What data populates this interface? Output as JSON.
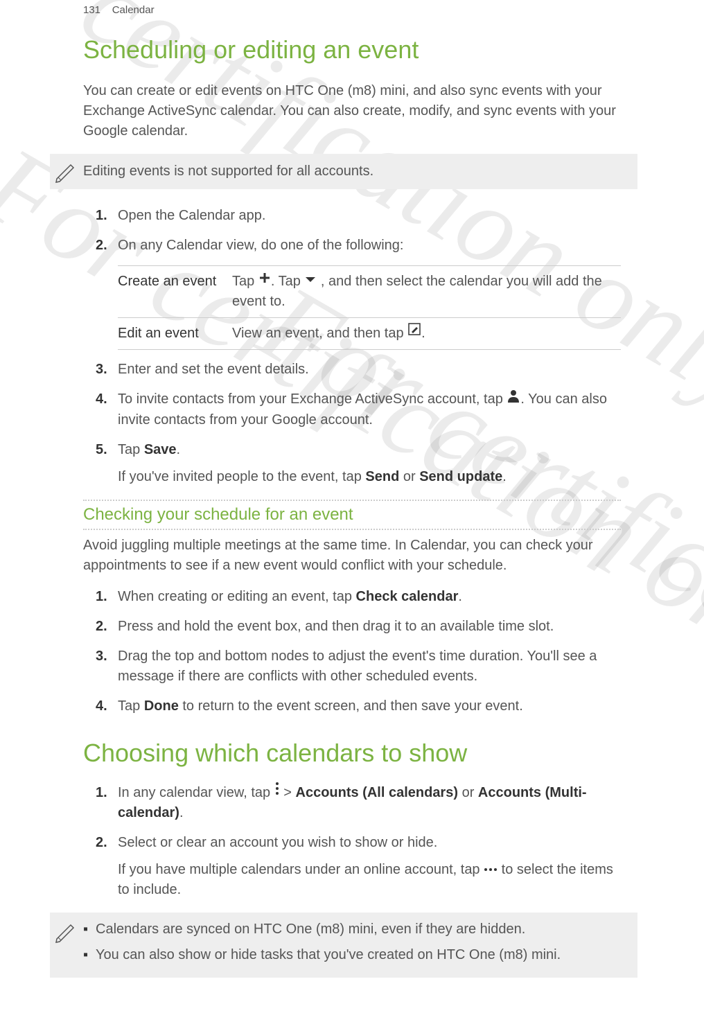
{
  "header": {
    "page_num": "131",
    "section": "Calendar"
  },
  "watermark_text": "For certification only",
  "section1": {
    "title": "Scheduling or editing an event",
    "intro": "You can create or edit events on HTC One (m8) mini, and also sync events with your Exchange ActiveSync calendar. You can also create, modify, and sync events with your Google calendar.",
    "note": "Editing events is not supported for all accounts.",
    "steps": {
      "s1": "Open the Calendar app.",
      "s2": "On any Calendar view, do one of the following:",
      "table": {
        "row1_label": "Create an event",
        "row1_prefix": "Tap ",
        "row1_mid": ". Tap ",
        "row1_suffix": " , and then select the calendar you will add the event to.",
        "row2_label": "Edit an event",
        "row2_prefix": "View an event, and then tap ",
        "row2_suffix": "."
      },
      "s3": "Enter and set the event details.",
      "s4_prefix": "To invite contacts from your Exchange ActiveSync account, tap ",
      "s4_suffix": ". You can also invite contacts from your Google account.",
      "s5_prefix": "Tap ",
      "s5_bold": "Save",
      "s5_suffix": ".",
      "s5_sub_prefix": "If you've invited people to the event, tap ",
      "s5_sub_b1": "Send",
      "s5_sub_mid": " or ",
      "s5_sub_b2": "Send update",
      "s5_sub_suffix": "."
    }
  },
  "section2": {
    "title": "Checking your schedule for an event",
    "intro": "Avoid juggling multiple meetings at the same time. In Calendar, you can check your appointments to see if a new event would conflict with your schedule.",
    "steps": {
      "s1_prefix": "When creating or editing an event, tap ",
      "s1_bold": "Check calendar",
      "s1_suffix": ".",
      "s2": "Press and hold the event box, and then drag it to an available time slot.",
      "s3": "Drag the top and bottom nodes to adjust the event's time duration. You'll see a message if there are conflicts with other scheduled events.",
      "s4_prefix": "Tap ",
      "s4_bold": "Done",
      "s4_suffix": " to return to the event screen, and then save your event."
    }
  },
  "section3": {
    "title": "Choosing which calendars to show",
    "steps": {
      "s1_prefix": "In any calendar view, tap ",
      "s1_mid": " > ",
      "s1_b1": "Accounts (All calendars)",
      "s1_mid2": " or ",
      "s1_b2": "Accounts (Multi-calendar)",
      "s1_suffix": ".",
      "s2": "Select or clear an account you wish to show or hide.",
      "s2_sub_prefix": "If you have multiple calendars under an online account, tap ",
      "s2_sub_suffix": " to select the items to include."
    },
    "tips": {
      "t1": "Calendars are synced on HTC One (m8) mini, even if they are hidden.",
      "t2": "You can also show or hide tasks that you've created on HTC One (m8) mini."
    }
  }
}
